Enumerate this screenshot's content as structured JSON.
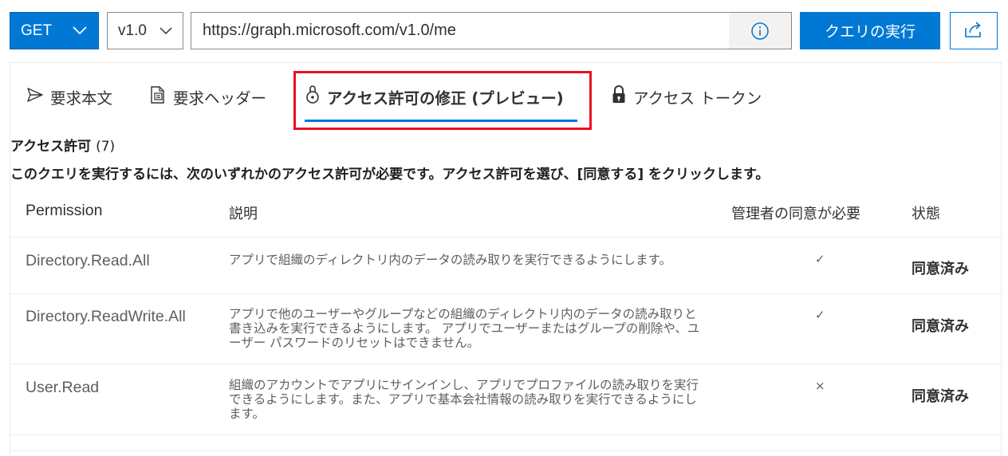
{
  "toolbar": {
    "method": "GET",
    "version": "v1.0",
    "url": "https://graph.microsoft.com/v1.0/me",
    "run_label": "クエリの実行"
  },
  "tabs": [
    {
      "label": "要求本文",
      "icon": "send-icon"
    },
    {
      "label": "要求ヘッダー",
      "icon": "document-header-icon"
    },
    {
      "label": "アクセス許可の修正 (プレビュー)",
      "icon": "permission-shield-icon",
      "active": true
    },
    {
      "label": "アクセス トークン",
      "icon": "lock-icon"
    }
  ],
  "permissions": {
    "heading": "アクセス許可",
    "count": "(7)",
    "description": "このクエリを実行するには、次のいずれかのアクセス許可が必要です。アクセス許可を選び、[同意する] をクリックします。",
    "columns": [
      "Permission",
      "説明",
      "管理者の同意が必要",
      "状態"
    ],
    "rows": [
      {
        "permission": "Directory.Read.All",
        "description": "アプリで組織のディレクトリ内のデータの読み取りを実行できるようにします。",
        "admin": "✓",
        "status": "同意済み"
      },
      {
        "permission": "Directory.ReadWrite.All",
        "description": "アプリで他のユーザーやグループなどの組織のディレクトリ内のデータの読み取りと書き込みを実行できるようにします。 アプリでユーザーまたはグループの削除や、ユーザー パスワードのリセットはできません。",
        "admin": "✓",
        "status": "同意済み"
      },
      {
        "permission": "User.Read",
        "description": "組織のアカウントでアプリにサインインし、アプリでプロファイルの読み取りを実行できるようにします。また、アプリで基本会社情報の読み取りを実行できるようにします。",
        "admin": "×",
        "status": "同意済み"
      }
    ]
  },
  "colors": {
    "accent": "#0078d4",
    "highlight_border": "#e81123"
  }
}
